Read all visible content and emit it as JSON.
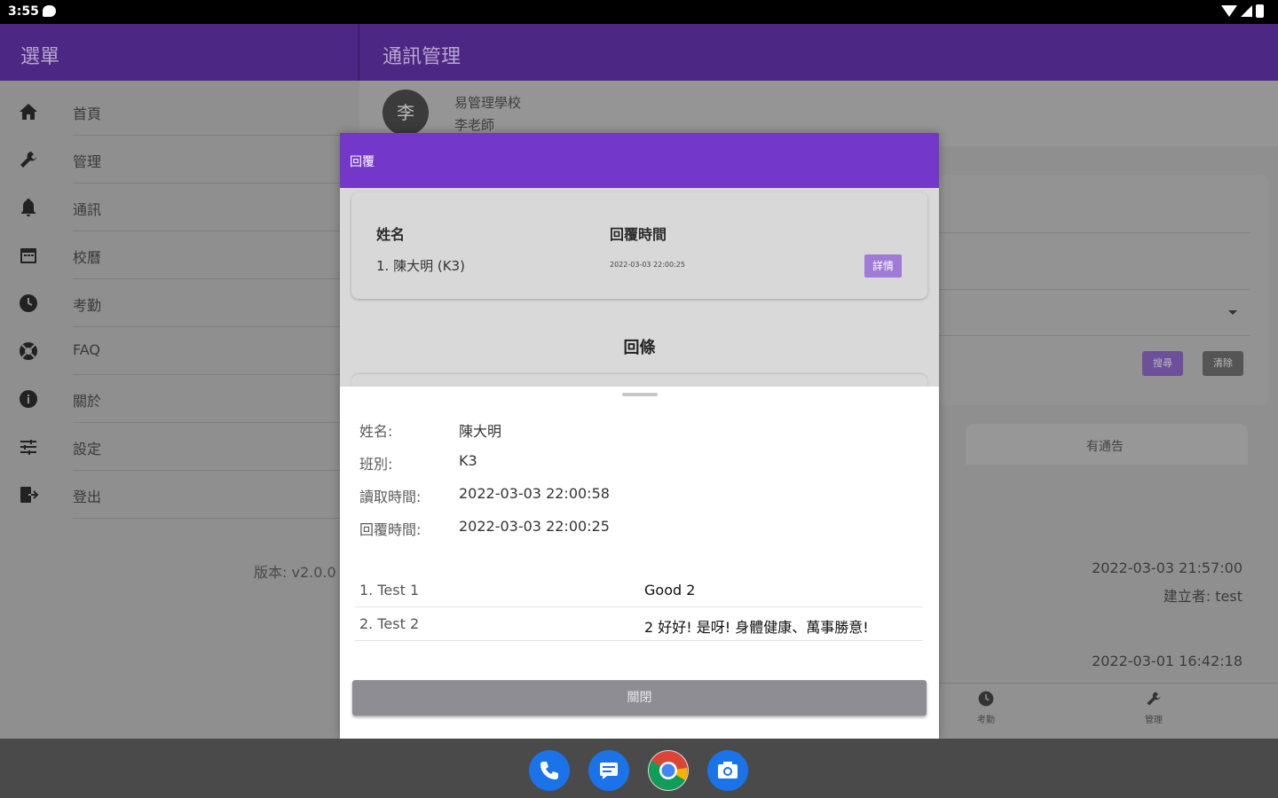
{
  "status_bar": {
    "time": "3:55"
  },
  "app_bar": {
    "menu_title": "選單",
    "page_title": "通訊管理"
  },
  "drawer": {
    "items": [
      {
        "icon": "home-icon",
        "label": "首頁"
      },
      {
        "icon": "wrench-icon",
        "label": "管理"
      },
      {
        "icon": "bell-icon",
        "label": "通訊"
      },
      {
        "icon": "calendar-icon",
        "label": "校曆"
      },
      {
        "icon": "clock-icon",
        "label": "考勤"
      },
      {
        "icon": "lifebuoy-icon",
        "label": "FAQ"
      },
      {
        "icon": "info-icon",
        "label": "關於"
      },
      {
        "icon": "sliders-icon",
        "label": "設定"
      },
      {
        "icon": "logout-icon",
        "label": "登出"
      }
    ],
    "version": "版本: v2.0.0"
  },
  "main": {
    "avatar_initial": "李",
    "school_name": "易管理學校",
    "teacher_name": "李老師",
    "search_button": "搜尋",
    "clear_button": "清除",
    "tab_label": "有通告",
    "item1_time": "2022-03-03 21:57:00",
    "item1_creator": "建立者: test",
    "item2_time": "2022-03-01 16:42:18",
    "bottom_nav": [
      {
        "icon": "clock-icon",
        "label": "考勤"
      },
      {
        "icon": "wrench-icon",
        "label": "管理"
      }
    ]
  },
  "dialog": {
    "title": "回覆",
    "col_name": "姓名",
    "col_reply_time": "回覆時間",
    "reply_name": "1. 陳大明 (K3)",
    "reply_time": "2022-03-03 22:00:25",
    "detail_button": "詳情",
    "reply_section_title": "回條",
    "info": [
      {
        "label": "姓名:",
        "value": "陳大明"
      },
      {
        "label": "班別:",
        "value": "K3"
      },
      {
        "label": "讀取時間:",
        "value": "2022-03-03 22:00:58"
      },
      {
        "label": "回覆時間:",
        "value": "2022-03-03 22:00:25"
      }
    ],
    "answers": [
      {
        "question": "1. Test 1",
        "answer": "Good 2"
      },
      {
        "question": "2. Test 2",
        "answer": "2 好好! 是呀! 身體健康、萬事勝意!"
      }
    ],
    "close_button": "關閉"
  },
  "dock": [
    "phone-icon",
    "messages-icon",
    "chrome-icon",
    "camera-icon"
  ],
  "colors": {
    "app_bar": "#4d2784",
    "dialog_header": "#7338c9",
    "accent_button": "#9f7ad6"
  }
}
